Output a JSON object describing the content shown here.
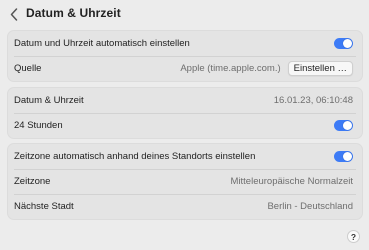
{
  "header": {
    "title": "Datum & Uhrzeit",
    "back_icon": "chevron-left-icon"
  },
  "group1": {
    "auto_time_label": "Datum und Uhrzeit automatisch einstellen",
    "auto_time_on": true,
    "source_label": "Quelle",
    "source_value": "Apple (time.apple.com.)",
    "source_button": "Einstellen …"
  },
  "group2": {
    "datetime_label": "Datum & Uhrzeit",
    "datetime_value": "16.01.23, 06:10:48",
    "h24_label": "24 Stunden",
    "h24_on": true
  },
  "group3": {
    "auto_tz_label": "Zeitzone automatisch anhand deines Standorts einstellen",
    "auto_tz_on": true,
    "tz_label": "Zeitzone",
    "tz_value": "Mitteleuropäische Normalzeit",
    "city_label": "Nächste Stadt",
    "city_value": "Berlin - Deutschland"
  },
  "footer": {
    "help_label": "?"
  },
  "colors": {
    "toggle_on": "#3d7bf6",
    "background": "#ececec",
    "group_background": "#e4e4e4"
  }
}
